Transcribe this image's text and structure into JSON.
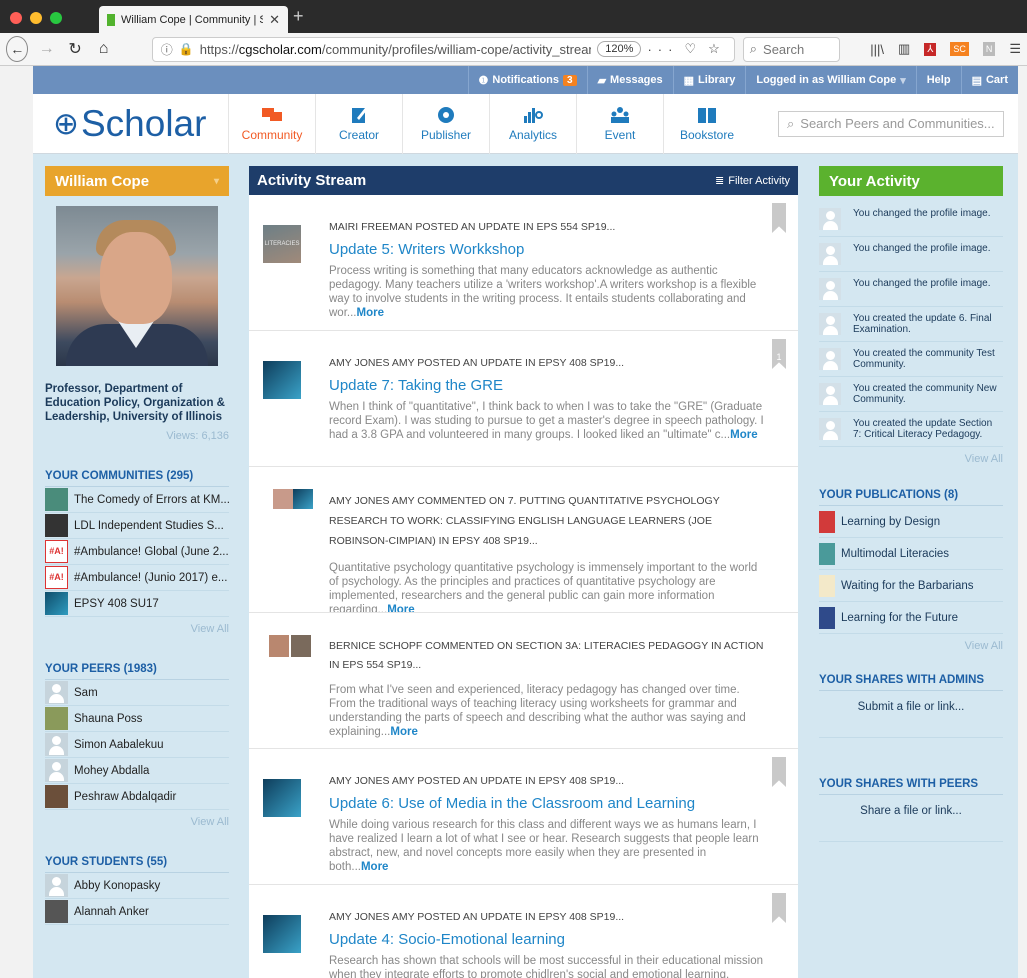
{
  "browser": {
    "tab_title": "William Cope | Community | Sch",
    "url_prefix": "https://",
    "url_host": "cgscholar.com",
    "url_path": "/community/profiles/william-cope/activity_strean",
    "zoom": "120%",
    "search_placeholder": "Search"
  },
  "topbar": {
    "notifications": "Notifications",
    "notifications_count": "3",
    "messages": "Messages",
    "library": "Library",
    "logged_in": "Logged in as William Cope",
    "help": "Help",
    "cart": "Cart"
  },
  "header": {
    "logo": "Scholar",
    "nav": [
      {
        "label": "Community",
        "icon": "community-icon"
      },
      {
        "label": "Creator",
        "icon": "creator-icon"
      },
      {
        "label": "Publisher",
        "icon": "publisher-icon"
      },
      {
        "label": "Analytics",
        "icon": "analytics-icon"
      },
      {
        "label": "Event",
        "icon": "event-icon"
      },
      {
        "label": "Bookstore",
        "icon": "bookstore-icon"
      }
    ],
    "search_placeholder": "Search Peers and Communities..."
  },
  "profile": {
    "name": "William Cope",
    "bio": "Professor, Department of Education Policy, Organization & Leadership, University of Illinois",
    "views": "Views: 6,136"
  },
  "communities": {
    "title": "YOUR COMMUNITIES (295)",
    "items": [
      "The Comedy of Errors at KM...",
      "LDL Independent Studies S...",
      "#Ambulance! Global (June 2...",
      "#Ambulance! (Junio 2017) e...",
      "EPSY 408 SU17"
    ],
    "view_all": "View All"
  },
  "peers": {
    "title": "YOUR PEERS (1983)",
    "items": [
      "Sam",
      "Shauna Poss",
      "Simon Aabalekuu",
      "Mohey Abdalla",
      "Peshraw Abdalqadir"
    ],
    "view_all": "View All"
  },
  "students": {
    "title": "YOUR STUDENTS (55)",
    "items": [
      "Abby Konopasky",
      "Alannah Anker"
    ]
  },
  "stream": {
    "title": "Activity Stream",
    "filter": "Filter Activity",
    "more": "More",
    "posts": [
      {
        "meta": "MAIRI FREEMAN POSTED AN UPDATE IN EPS 554 SP19...",
        "title": "Update 5: Writers Workkshop",
        "body": "Process writing is something that many educators acknowledge as authentic pedagogy. Many teachers utilize a 'writers workshop'.A writers workshop is a flexible way to involve students in the writing process. It entails students collaborating and wor...",
        "thumb_label": "LITERACIES"
      },
      {
        "meta": "AMY JONES AMY POSTED AN UPDATE IN EPSY 408 SP19...",
        "title": "Update 7: Taking the GRE",
        "body": "When I think of \"quantitative\", I think back to when I was to take the \"GRE\" (Graduate record Exam). I was studing to pursue to get a master's degree in speech pathology. I had a 3.8 GPA and volunteered in many groups. I looked liked an \"ultimate\" c...",
        "bookmark_count": "1"
      },
      {
        "meta": "AMY JONES AMY COMMENTED ON 7. PUTTING QUANTITATIVE PSYCHOLOGY RESEARCH TO WORK: CLASSIFYING ENGLISH LANGUAGE LEARNERS (JOE ROBINSON-CIMPIAN) IN EPSY 408 SP19...",
        "body": "Quantitative psychology quantitative psychology is immensely important to the world of psychology. As the principles and practices of quantitative psychology are implemented, researchers and the general public can gain more information regarding..."
      },
      {
        "meta": "BERNICE SCHOPF COMMENTED ON SECTION 3A: LITERACIES PEDAGOGY IN ACTION IN EPS 554 SP19...",
        "body": "From what I've seen and experienced, literacy pedagogy has changed over time. From the traditional ways of teaching literacy using worksheets for grammar and understanding the parts of speech and describing what the author was saying and explaining..."
      },
      {
        "meta": "AMY JONES AMY POSTED AN UPDATE IN EPSY 408 SP19...",
        "title": "Update 6: Use of Media in the Classroom and Learning",
        "body": "While doing various research for this class and different ways we as humans learn, I have realized I learn a lot of what I see or hear. Research suggests that people learn abstract, new, and novel concepts more easily when they are presented in both..."
      },
      {
        "meta": "AMY JONES AMY POSTED AN UPDATE IN EPSY 408 SP19...",
        "title": "Update 4: Socio-Emotional learning",
        "body": "Research has shown that schools will be most successful in their educational mission when they integrate efforts to promote chidlren's social and emotional learning. Schools toady are multicultural and multilingual with students from diverse social..."
      }
    ]
  },
  "activity": {
    "title": "Your Activity",
    "items": [
      "You changed the profile image.",
      "You changed the profile image.",
      "You changed the profile image.",
      "You created the update 6. Final Examination.",
      "You created the community Test Community.",
      "You created the community New Community.",
      "You created the update Section 7: Critical Literacy Pedagogy."
    ],
    "view_all": "View All"
  },
  "publications": {
    "title": "YOUR PUBLICATIONS (8)",
    "items": [
      "Learning by Design",
      "Multimodal Literacies",
      "Waiting for the Barbarians",
      "Learning for the Future"
    ],
    "view_all": "View All"
  },
  "shares_admins": {
    "title": "YOUR SHARES WITH ADMINS",
    "link": "Submit a file or link..."
  },
  "shares_peers": {
    "title": "YOUR SHARES WITH PEERS",
    "link": "Share a file or link..."
  },
  "colors": {
    "profile_header": "#e8a42c",
    "stream_header": "#1e3d6a",
    "activity_header": "#5bb22e",
    "link": "#1f86c8",
    "active_nav": "#f15a24"
  }
}
